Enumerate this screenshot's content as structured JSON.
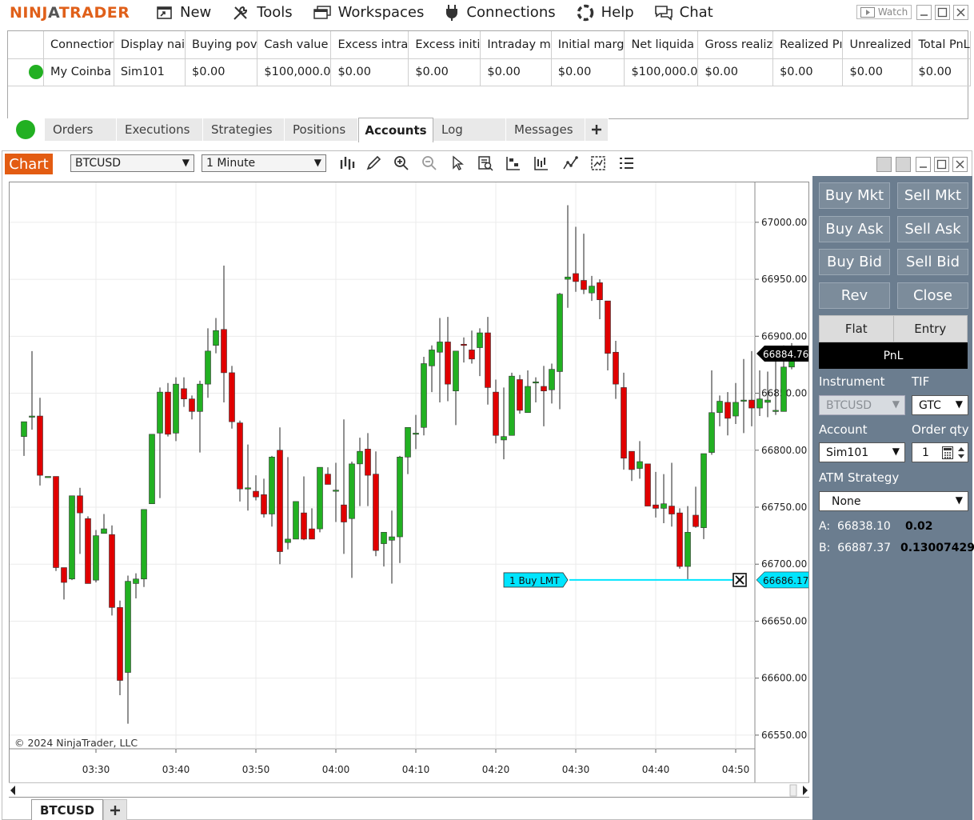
{
  "app": {
    "logo_part1": "NINJ",
    "logo_part2": "A",
    "logo_part3": "TRADER"
  },
  "menu": [
    {
      "label": "New",
      "icon": "new-window-icon"
    },
    {
      "label": "Tools",
      "icon": "tools-icon"
    },
    {
      "label": "Workspaces",
      "icon": "workspaces-icon"
    },
    {
      "label": "Connections",
      "icon": "plug-icon"
    },
    {
      "label": "Help",
      "icon": "help-lifebuoy-icon"
    },
    {
      "label": "Chat",
      "icon": "chat-bubble-icon"
    }
  ],
  "watch_label": "Watch",
  "accounts": {
    "columns": [
      "Connectior",
      "Display nai",
      "Buying pov",
      "Cash value",
      "Excess intra",
      "Excess initi",
      "Intraday m",
      "Initial marg",
      "Net liquida",
      "Gross realiz",
      "Realized Pı",
      "Unrealized",
      "Total PnL"
    ],
    "row": [
      "My Coinba",
      "Sim101",
      "$0.00",
      "$100,000.0",
      "$0.00",
      "$0.00",
      "$0.00",
      "$0.00",
      "$100,000.0",
      "$0.00",
      "$0.00",
      "$0.00",
      "$0.00"
    ]
  },
  "tabs": [
    {
      "label": "Orders",
      "active": false
    },
    {
      "label": "Executions",
      "active": false
    },
    {
      "label": "Strategies",
      "active": false
    },
    {
      "label": "Positions",
      "active": false
    },
    {
      "label": "Accounts",
      "active": true
    },
    {
      "label": "Log",
      "active": false
    },
    {
      "label": "Messages",
      "active": false
    }
  ],
  "chart_window": {
    "title": "Chart",
    "instrument": "BTCUSD",
    "interval": "1 Minute",
    "copyright": "© 2024 NinjaTrader, LLC",
    "bottom_tab": "BTCUSD"
  },
  "chart_data": {
    "type": "candlestick",
    "yticks": [
      "67000.00",
      "66950.00",
      "66900.00",
      "66850.00",
      "66800.00",
      "66750.00",
      "66700.00",
      "66650.00",
      "66600.00",
      "66550.00"
    ],
    "xticks": [
      "03:30",
      "03:40",
      "03:50",
      "04:00",
      "04:10",
      "04:20",
      "04:30",
      "04:40",
      "04:50"
    ],
    "ylim": [
      66538,
      67035
    ],
    "last_price": "66884.76",
    "order_line": {
      "label": "1  Buy LMT",
      "price": "66686.17",
      "price_value": 66686.17
    },
    "colors": {
      "up": "#22b022",
      "down": "#e00000",
      "order": "#00e5ff",
      "grid": "#ebebeb"
    },
    "candles": [
      {
        "o": 66812,
        "h": 66825,
        "l": 66795,
        "c": 66825
      },
      {
        "o": 66830,
        "h": 66887,
        "l": 66818,
        "c": 66830
      },
      {
        "o": 66830,
        "h": 66846,
        "l": 66769,
        "c": 66778
      },
      {
        "o": 66777,
        "h": 66777,
        "l": 66777,
        "c": 66777
      },
      {
        "o": 66777,
        "h": 66777,
        "l": 66694,
        "c": 66697
      },
      {
        "o": 66697,
        "h": 66693,
        "l": 66669,
        "c": 66684
      },
      {
        "o": 66687,
        "h": 66760,
        "l": 66686,
        "c": 66760
      },
      {
        "o": 66760,
        "h": 66767,
        "l": 66709,
        "c": 66745
      },
      {
        "o": 66740,
        "h": 66742,
        "l": 66683,
        "c": 66683
      },
      {
        "o": 66686,
        "h": 66730,
        "l": 66684,
        "c": 66725
      },
      {
        "o": 66727,
        "h": 66744,
        "l": 66727,
        "c": 66731
      },
      {
        "o": 66726,
        "h": 66734,
        "l": 66655,
        "c": 66662
      },
      {
        "o": 66662,
        "h": 66668,
        "l": 66585,
        "c": 66598
      },
      {
        "o": 66605,
        "h": 66690,
        "l": 66560,
        "c": 66685
      },
      {
        "o": 66683,
        "h": 66692,
        "l": 66670,
        "c": 66687
      },
      {
        "o": 66687,
        "h": 66748,
        "l": 66680,
        "c": 66748
      },
      {
        "o": 66753,
        "h": 66814,
        "l": 66753,
        "c": 66814
      },
      {
        "o": 66815,
        "h": 66855,
        "l": 66758,
        "c": 66851
      },
      {
        "o": 66851,
        "h": 66859,
        "l": 66812,
        "c": 66814
      },
      {
        "o": 66815,
        "h": 66864,
        "l": 66808,
        "c": 66858
      },
      {
        "o": 66854,
        "h": 66864,
        "l": 66838,
        "c": 66845
      },
      {
        "o": 66845,
        "h": 66848,
        "l": 66827,
        "c": 66834
      },
      {
        "o": 66834,
        "h": 66861,
        "l": 66798,
        "c": 66858
      },
      {
        "o": 66858,
        "h": 66907,
        "l": 66846,
        "c": 66887
      },
      {
        "o": 66892,
        "h": 66916,
        "l": 66885,
        "c": 66905
      },
      {
        "o": 66906,
        "h": 66962,
        "l": 66842,
        "c": 66868
      },
      {
        "o": 66868,
        "h": 66874,
        "l": 66819,
        "c": 66825
      },
      {
        "o": 66824,
        "h": 66826,
        "l": 66755,
        "c": 66766
      },
      {
        "o": 66766,
        "h": 66805,
        "l": 66747,
        "c": 66767
      },
      {
        "o": 66764,
        "h": 66778,
        "l": 66756,
        "c": 66759
      },
      {
        "o": 66761,
        "h": 66775,
        "l": 66741,
        "c": 66744
      },
      {
        "o": 66744,
        "h": 66795,
        "l": 66733,
        "c": 66794
      },
      {
        "o": 66800,
        "h": 66820,
        "l": 66700,
        "c": 66711
      },
      {
        "o": 66719,
        "h": 66794,
        "l": 66713,
        "c": 66722
      },
      {
        "o": 66722,
        "h": 66755,
        "l": 66730,
        "c": 66755
      },
      {
        "o": 66745,
        "h": 66777,
        "l": 66721,
        "c": 66722
      },
      {
        "o": 66731,
        "h": 66749,
        "l": 66722,
        "c": 66722
      },
      {
        "o": 66731,
        "h": 66785,
        "l": 66728,
        "c": 66785
      },
      {
        "o": 66779,
        "h": 66785,
        "l": 66770,
        "c": 66770
      },
      {
        "o": 66765,
        "h": 66789,
        "l": 66737,
        "c": 66765
      },
      {
        "o": 66752,
        "h": 66827,
        "l": 66709,
        "c": 66737
      },
      {
        "o": 66740,
        "h": 66790,
        "l": 66688,
        "c": 66788
      },
      {
        "o": 66788,
        "h": 66811,
        "l": 66751,
        "c": 66799
      },
      {
        "o": 66801,
        "h": 66815,
        "l": 66751,
        "c": 66778
      },
      {
        "o": 66779,
        "h": 66799,
        "l": 66707,
        "c": 66712
      },
      {
        "o": 66718,
        "h": 66705,
        "l": 66698,
        "c": 66728
      },
      {
        "o": 66721,
        "h": 66747,
        "l": 66683,
        "c": 66724
      },
      {
        "o": 66724,
        "h": 66795,
        "l": 66701,
        "c": 66794
      },
      {
        "o": 66794,
        "h": 66817,
        "l": 66779,
        "c": 66820
      },
      {
        "o": 66815,
        "h": 66831,
        "l": 66801,
        "c": 66815
      },
      {
        "o": 66820,
        "h": 66882,
        "l": 66813,
        "c": 66876
      },
      {
        "o": 66874,
        "h": 66892,
        "l": 66851,
        "c": 66888
      },
      {
        "o": 66886,
        "h": 66916,
        "l": 66842,
        "c": 66895
      },
      {
        "o": 66895,
        "h": 66917,
        "l": 66843,
        "c": 66858
      },
      {
        "o": 66852,
        "h": 66886,
        "l": 66822,
        "c": 66887
      },
      {
        "o": 66893,
        "h": 66899,
        "l": 66877,
        "c": 66892
      },
      {
        "o": 66888,
        "h": 66905,
        "l": 66876,
        "c": 66880
      },
      {
        "o": 66890,
        "h": 66907,
        "l": 66865,
        "c": 66903
      },
      {
        "o": 66903,
        "h": 66917,
        "l": 66840,
        "c": 66855
      },
      {
        "o": 66851,
        "h": 66862,
        "l": 66806,
        "c": 66813
      },
      {
        "o": 66809,
        "h": 66855,
        "l": 66792,
        "c": 66812
      },
      {
        "o": 66813,
        "h": 66868,
        "l": 66813,
        "c": 66865
      },
      {
        "o": 66862,
        "h": 66866,
        "l": 66832,
        "c": 66835
      },
      {
        "o": 66833,
        "h": 66870,
        "l": 66838,
        "c": 66856
      },
      {
        "o": 66860,
        "h": 66864,
        "l": 66842,
        "c": 66860
      },
      {
        "o": 66856,
        "h": 66874,
        "l": 66821,
        "c": 66852
      },
      {
        "o": 66853,
        "h": 66876,
        "l": 66841,
        "c": 66871
      },
      {
        "o": 66869,
        "h": 66938,
        "l": 66836,
        "c": 66937
      },
      {
        "o": 66950,
        "h": 67015,
        "l": 66925,
        "c": 66952
      },
      {
        "o": 66955,
        "h": 66996,
        "l": 66939,
        "c": 66948
      },
      {
        "o": 66949,
        "h": 66990,
        "l": 66937,
        "c": 66941
      },
      {
        "o": 66938,
        "h": 66953,
        "l": 66931,
        "c": 66944
      },
      {
        "o": 66947,
        "h": 66950,
        "l": 66915,
        "c": 66932
      },
      {
        "o": 66931,
        "h": 66931,
        "l": 66870,
        "c": 66885
      },
      {
        "o": 66886,
        "h": 66896,
        "l": 66845,
        "c": 66858
      },
      {
        "o": 66855,
        "h": 66868,
        "l": 66783,
        "c": 66793
      },
      {
        "o": 66799,
        "h": 66781,
        "l": 66773,
        "c": 66783
      },
      {
        "o": 66784,
        "h": 66808,
        "l": 66775,
        "c": 66790
      },
      {
        "o": 66788,
        "h": 66788,
        "l": 66751,
        "c": 66751
      },
      {
        "o": 66752,
        "h": 66781,
        "l": 66741,
        "c": 66749
      },
      {
        "o": 66749,
        "h": 66779,
        "l": 66736,
        "c": 66753
      },
      {
        "o": 66751,
        "h": 66789,
        "l": 66733,
        "c": 66744
      },
      {
        "o": 66745,
        "h": 66749,
        "l": 66696,
        "c": 66698
      },
      {
        "o": 66698,
        "h": 66751,
        "l": 66686,
        "c": 66728
      },
      {
        "o": 66743,
        "h": 66768,
        "l": 66732,
        "c": 66733
      },
      {
        "o": 66732,
        "h": 66797,
        "l": 66722,
        "c": 66797
      },
      {
        "o": 66798,
        "h": 66870,
        "l": 66796,
        "c": 66833
      },
      {
        "o": 66833,
        "h": 66848,
        "l": 66821,
        "c": 66843
      },
      {
        "o": 66842,
        "h": 66851,
        "l": 66813,
        "c": 66828
      },
      {
        "o": 66830,
        "h": 66859,
        "l": 66823,
        "c": 66842
      },
      {
        "o": 66843,
        "h": 66880,
        "l": 66815,
        "c": 66844
      },
      {
        "o": 66844,
        "h": 66887,
        "l": 66821,
        "c": 66837
      },
      {
        "o": 66837,
        "h": 66870,
        "l": 66830,
        "c": 66845
      },
      {
        "o": 66842,
        "h": 66869,
        "l": 66829,
        "c": 66844
      },
      {
        "o": 66835,
        "h": 66880,
        "l": 66831,
        "c": 66835
      },
      {
        "o": 66834,
        "h": 66892,
        "l": 66834,
        "c": 66873
      },
      {
        "o": 66873,
        "h": 66894,
        "l": 66871,
        "c": 66885
      }
    ]
  },
  "order_panel": {
    "buttons": [
      [
        "Buy Mkt",
        "Sell Mkt"
      ],
      [
        "Buy Ask",
        "Sell Ask"
      ],
      [
        "Buy Bid",
        "Sell Bid"
      ],
      [
        "Rev",
        "Close"
      ]
    ],
    "flat_label": "Flat",
    "entry_label": "Entry",
    "pnl_label": "PnL",
    "instrument_label": "Instrument",
    "instrument_value": "BTCUSD",
    "tif_label": "TIF",
    "tif_value": "GTC",
    "account_label": "Account",
    "account_value": "Sim101",
    "qty_label": "Order qty",
    "qty_value": "1",
    "atm_label": "ATM Strategy",
    "atm_value": "None",
    "ask_label": "A:",
    "ask_price": "66838.10",
    "ask_size": "0.02",
    "bid_label": "B:",
    "bid_price": "66887.37",
    "bid_size": "0.13007429"
  }
}
